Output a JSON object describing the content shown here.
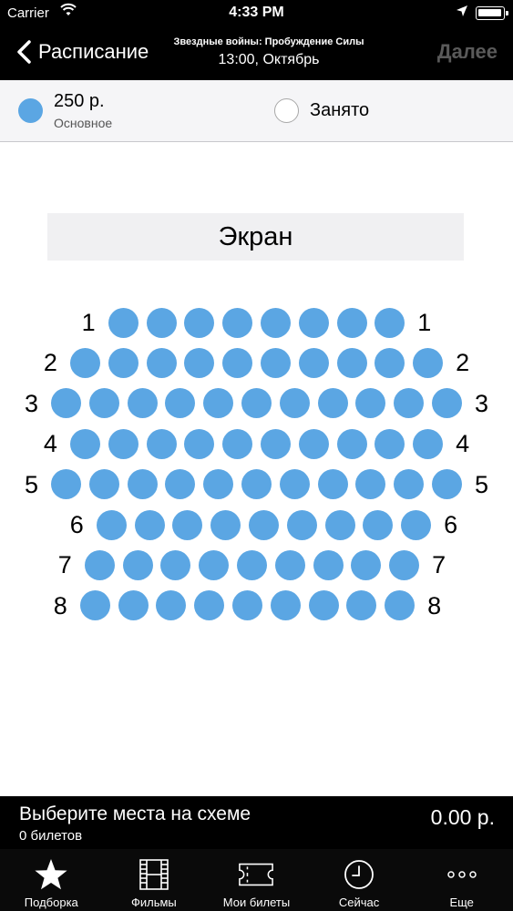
{
  "status": {
    "carrier": "Carrier",
    "time": "4:33 PM"
  },
  "nav": {
    "back_label": "Расписание",
    "title": "Звездные войны: Пробуждение Силы",
    "subtitle": "13:00, Октябрь",
    "next_label": "Далее"
  },
  "legend": {
    "price": "250 р.",
    "price_type": "Основное",
    "busy_label": "Занято",
    "free_color": "#5ba6e3"
  },
  "screen_label": "Экран",
  "rows": [
    {
      "label": "1",
      "seats": 8
    },
    {
      "label": "2",
      "seats": 10
    },
    {
      "label": "3",
      "seats": 11
    },
    {
      "label": "4",
      "seats": 10
    },
    {
      "label": "5",
      "seats": 11
    },
    {
      "label": "6",
      "seats": 9
    },
    {
      "label": "7",
      "seats": 9
    },
    {
      "label": "8",
      "seats": 9
    }
  ],
  "selection": {
    "hint": "Выберите места на схеме",
    "count": "0 билетов",
    "total": "0.00 р."
  },
  "tabs": [
    {
      "label": "Подборка",
      "icon": "star-icon"
    },
    {
      "label": "Фильмы",
      "icon": "film-icon"
    },
    {
      "label": "Мои билеты",
      "icon": "ticket-icon"
    },
    {
      "label": "Сейчас",
      "icon": "clock-icon"
    },
    {
      "label": "Еще",
      "icon": "more-icon"
    }
  ]
}
